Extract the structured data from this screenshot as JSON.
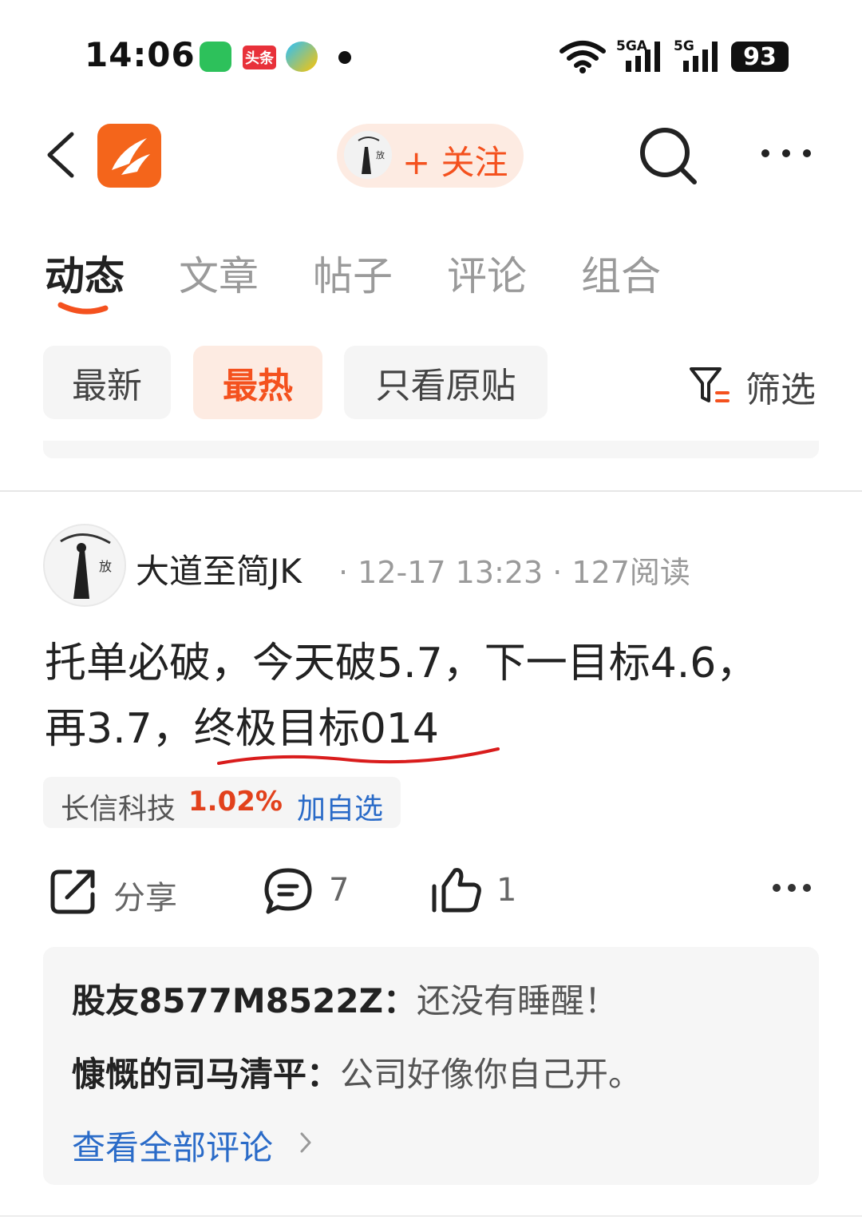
{
  "status_bar": {
    "time": "14:06",
    "toutiao_label": "头条",
    "network1": "5GA",
    "network2": "5G",
    "battery": "93",
    "icons": [
      "wechat-icon",
      "toutiao-icon",
      "tencent-video-icon",
      "notification-dot",
      "wifi-icon",
      "signal-icon",
      "signal-icon",
      "battery-icon"
    ]
  },
  "header": {
    "follow_label": "+ 关注",
    "follow_avatar_char": "放",
    "icons": [
      "back-icon",
      "app-logo",
      "search-icon",
      "more-icon"
    ]
  },
  "tabs": [
    {
      "label": "动态",
      "active": true
    },
    {
      "label": "文章",
      "active": false
    },
    {
      "label": "帖子",
      "active": false
    },
    {
      "label": "评论",
      "active": false
    },
    {
      "label": "组合",
      "active": false
    }
  ],
  "filters": {
    "chips": [
      {
        "label": "最新",
        "active": false
      },
      {
        "label": "最热",
        "active": true
      },
      {
        "label": "只看原贴",
        "active": false
      }
    ],
    "filter_label": "筛选"
  },
  "post": {
    "author": "大道至简JK",
    "avatar_char": "放",
    "meta": "· 12-17 13:23 · 127阅读",
    "text_line1": "托单必破，今天破5.7，下一目标4.6，",
    "text_line2": "再3.7，终极目标014",
    "stock": {
      "name": "长信科技",
      "change": "1.02%",
      "add_label": "加自选"
    },
    "actions": {
      "share_label": "分享",
      "comment_count": "7",
      "like_count": "1"
    }
  },
  "comments": {
    "items": [
      {
        "name": "股友8577M8522Z：",
        "text": "还没有睡醒！"
      },
      {
        "name": "慷慨的司马清平：",
        "text": "公司好像你自己开。"
      }
    ],
    "view_all": "查看全部评论"
  },
  "colors": {
    "accent": "#f4511e",
    "link": "#2a6bc8",
    "annotation_red": "#d91c1c"
  }
}
